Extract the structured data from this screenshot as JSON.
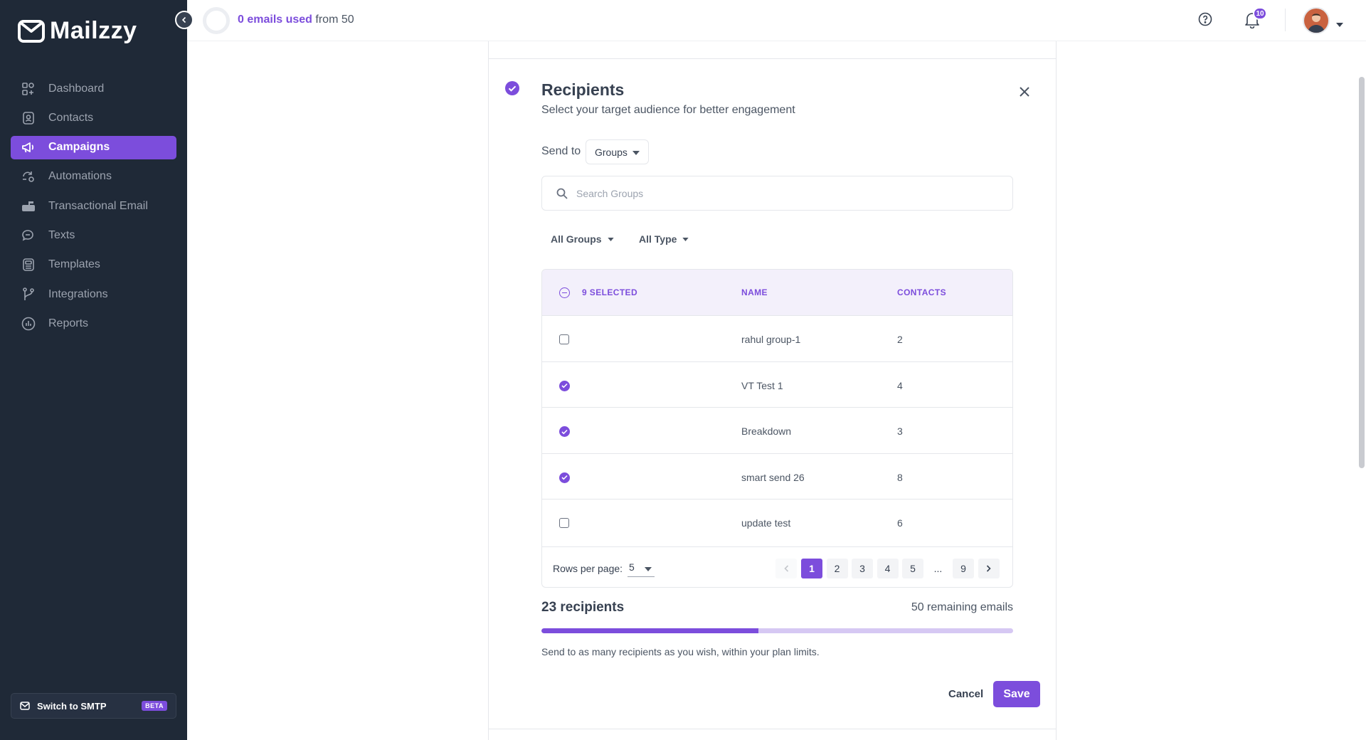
{
  "brand": {
    "name": "Mailzzy"
  },
  "sidebar": {
    "items": [
      {
        "label": "Dashboard",
        "icon": "dashboard-icon"
      },
      {
        "label": "Contacts",
        "icon": "contacts-icon"
      },
      {
        "label": "Campaigns",
        "icon": "megaphone-icon",
        "active": true
      },
      {
        "label": "Automations",
        "icon": "automation-icon"
      },
      {
        "label": "Transactional Email",
        "icon": "mailbox-icon"
      },
      {
        "label": "Texts",
        "icon": "chat-icon"
      },
      {
        "label": "Templates",
        "icon": "template-icon"
      },
      {
        "label": "Integrations",
        "icon": "branch-icon"
      },
      {
        "label": "Reports",
        "icon": "chart-icon"
      }
    ],
    "smtp": {
      "label": "Switch to SMTP",
      "badge": "BETA"
    }
  },
  "topbar": {
    "usage_used": "0 emails used",
    "usage_from": "from 50",
    "notifications": "10"
  },
  "recipients_panel": {
    "title": "Recipients",
    "subtitle": "Select your target audience for better engagement",
    "send_to_label": "Send to",
    "send_to_value": "Groups",
    "search_placeholder": "Search Groups",
    "filters": {
      "groups": "All Groups",
      "type": "All Type"
    },
    "table": {
      "selected_label": "9 SELECTED",
      "col_name": "NAME",
      "col_contacts": "CONTACTS",
      "rows": [
        {
          "name": "rahul group-1",
          "contacts": "2",
          "checked": false
        },
        {
          "name": "VT Test 1",
          "contacts": "4",
          "checked": true
        },
        {
          "name": "Breakdown",
          "contacts": "3",
          "checked": true
        },
        {
          "name": "smart send 26",
          "contacts": "8",
          "checked": true
        },
        {
          "name": "update test",
          "contacts": "6",
          "checked": false
        }
      ],
      "rows_per_page_label": "Rows per page:",
      "rows_per_page_value": "5",
      "pages": [
        "1",
        "2",
        "3",
        "4",
        "5",
        "...",
        "9"
      ],
      "current_page": "1"
    },
    "recipients_count": "23 recipients",
    "remaining": "50 remaining emails",
    "progress_percent": 46,
    "hint": "Send to as many recipients as you wish, within your plan limits.",
    "cancel_label": "Cancel",
    "save_label": "Save"
  },
  "colors": {
    "accent": "#7c4ddc",
    "sidebar": "#1f2937"
  }
}
